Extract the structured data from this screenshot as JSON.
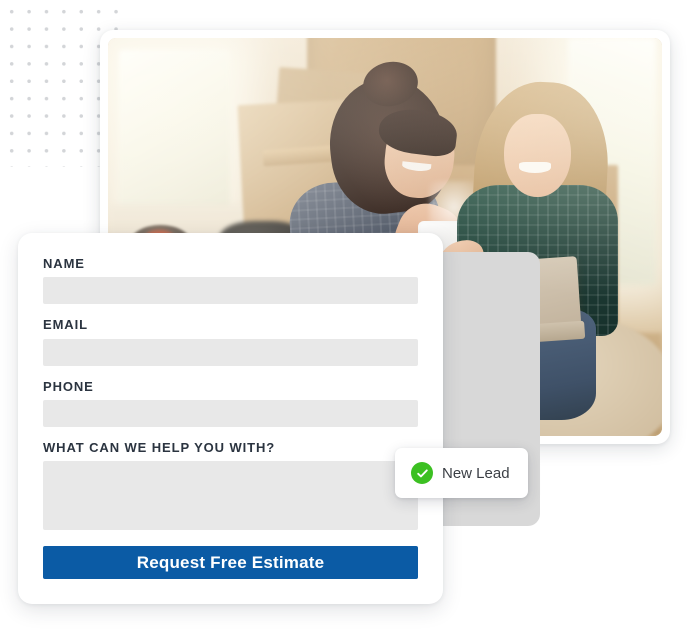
{
  "page": {
    "title": "Request Free Estimate Lead Form"
  },
  "photo_card": {
    "alt": "Two women sitting among cardboard moving boxes, one holding a coffee mug and one using a laptop",
    "scene_name": "moving-day-photo"
  },
  "form": {
    "fields": [
      {
        "label": "NAME",
        "value": "",
        "placeholder": "",
        "name": "name"
      },
      {
        "label": "EMAIL",
        "value": "",
        "placeholder": "",
        "name": "email"
      },
      {
        "label": "PHONE",
        "value": "",
        "placeholder": "",
        "name": "phone"
      }
    ],
    "message": {
      "label": "WHAT CAN WE HELP YOU WITH?",
      "value": "",
      "placeholder": "",
      "name": "message"
    },
    "submit_label": "Request Free Estimate"
  },
  "badge": {
    "label": "New Lead",
    "icon": "check-circle-icon"
  },
  "decor": {
    "dot_grid": "dot-grid-pattern"
  },
  "colors": {
    "accent_blue": "#0b5ba5",
    "success_green": "#3cc022",
    "input_gray": "#e8e8e8",
    "label_dark": "#2b3440",
    "back_panel_gray": "#d8d8d8",
    "dot_gray": "#d3d5d8"
  }
}
